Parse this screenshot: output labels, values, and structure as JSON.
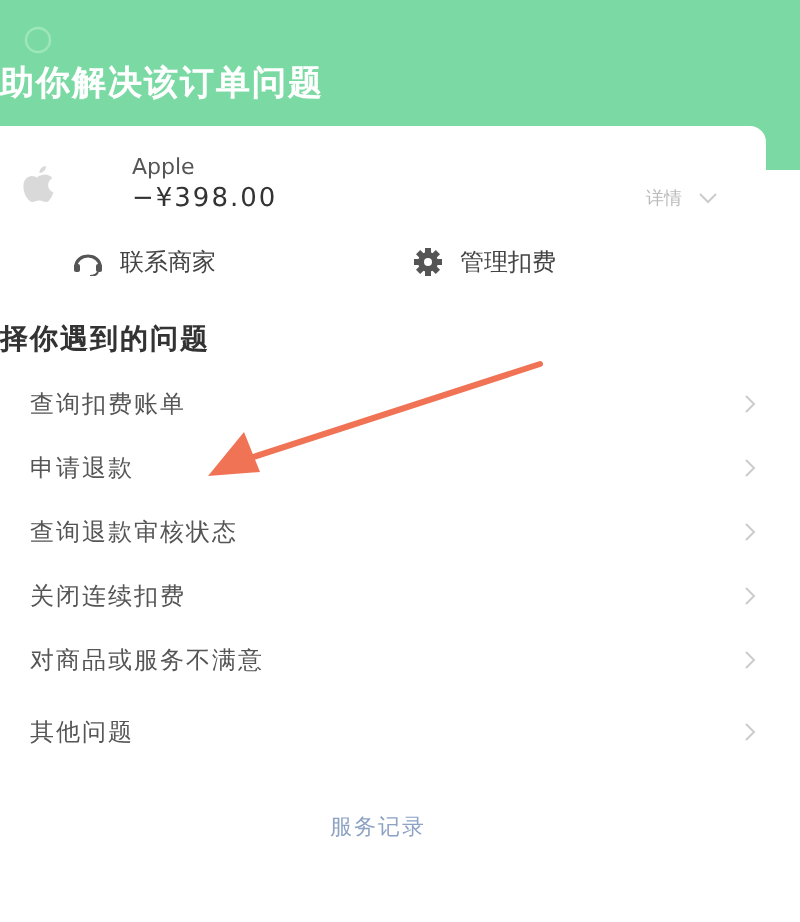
{
  "header": {
    "title": "助你解决该订单问题"
  },
  "order": {
    "merchant": "Apple",
    "amount": "−¥398.00",
    "detail_label": "详情"
  },
  "actions": [
    {
      "kind": "contact",
      "label": "联系商家"
    },
    {
      "kind": "settings",
      "label": "管理扣费"
    }
  ],
  "issues_heading": "择你遇到的问题",
  "issues": [
    {
      "label": "查询扣费账单"
    },
    {
      "label": "申请退款"
    },
    {
      "label": "查询退款审核状态"
    },
    {
      "label": "关闭连续扣费"
    },
    {
      "label": "对商品或服务不满意"
    },
    {
      "label": "其他问题"
    }
  ],
  "footer_link": "服务记录"
}
